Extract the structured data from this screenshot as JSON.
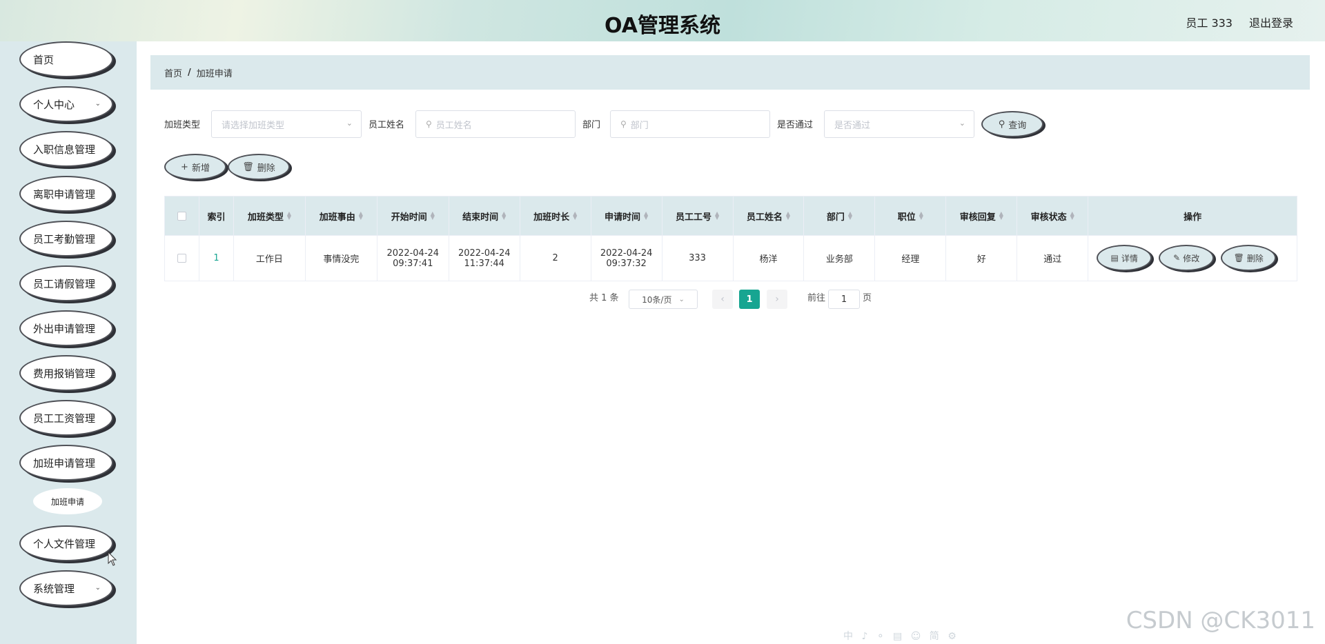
{
  "header": {
    "title": "OA管理系统",
    "user": "员工 333",
    "logout": "退出登录"
  },
  "sidebar": {
    "items": [
      {
        "label": "首页"
      },
      {
        "label": "个人中心",
        "chevron": "⌄"
      },
      {
        "label": "入职信息管理"
      },
      {
        "label": "离职申请管理"
      },
      {
        "label": "员工考勤管理"
      },
      {
        "label": "员工请假管理"
      },
      {
        "label": "外出申请管理"
      },
      {
        "label": "费用报销管理"
      },
      {
        "label": "员工工资管理"
      },
      {
        "label": "加班申请管理"
      },
      {
        "label": "个人文件管理"
      },
      {
        "label": "系统管理",
        "chevron": "⌄"
      }
    ],
    "sub_item": "加班申请"
  },
  "breadcrumb": {
    "home": "首页",
    "sep": "/",
    "current": "加班申请"
  },
  "search": {
    "type_label": "加班类型",
    "type_placeholder": "请选择加班类型",
    "name_label": "员工姓名",
    "name_placeholder": "员工姓名",
    "dept_label": "部门",
    "dept_placeholder": "部门",
    "pass_label": "是否通过",
    "pass_placeholder": "是否通过",
    "query_button": "查询"
  },
  "actions": {
    "add": "新增",
    "delete": "删除"
  },
  "table": {
    "headers": [
      "索引",
      "加班类型",
      "加班事由",
      "开始时间",
      "结束时间",
      "加班时长",
      "申请时间",
      "员工工号",
      "员工姓名",
      "部门",
      "职位",
      "审核回复",
      "审核状态",
      "操作"
    ],
    "rows": [
      {
        "index": "1",
        "type": "工作日",
        "reason": "事情没完",
        "start_date": "2022-04-24",
        "start_time": "09:37:41",
        "end_date": "2022-04-24",
        "end_time": "11:37:44",
        "hours": "2",
        "apply_date": "2022-04-24",
        "apply_time": "09:37:32",
        "emp_no": "333",
        "emp_name": "杨洋",
        "dept": "业务部",
        "position": "经理",
        "reply": "好",
        "status": "通过"
      }
    ],
    "row_actions": {
      "detail": "详情",
      "edit": "修改",
      "delete": "删除"
    }
  },
  "pagination": {
    "total": "共 1 条",
    "page_size": "10条/页",
    "current_page": "1",
    "goto_prefix": "前往",
    "goto_value": "1",
    "goto_suffix": "页"
  },
  "watermark": "CSDN @CK3011",
  "ime_toolbar": "中 ♪ ⚬ ▤ ☺ 简 ⚙",
  "colors": {
    "accent": "#17a591",
    "panel": "#dbe9ec",
    "button_border": "#4f5157"
  }
}
